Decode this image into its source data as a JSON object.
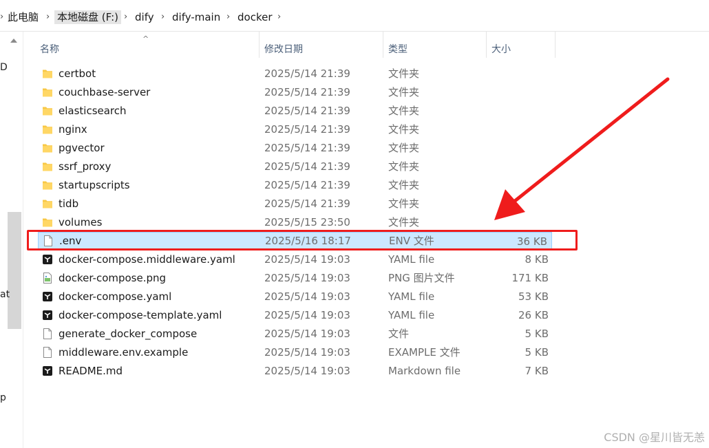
{
  "breadcrumb": [
    "此电脑",
    "本地磁盘 (F:)",
    "dify",
    "dify-main",
    "docker"
  ],
  "nav_fragments": [
    "D",
    "at",
    "p"
  ],
  "columns": {
    "name": "名称",
    "date": "修改日期",
    "type": "类型",
    "size": "大小"
  },
  "files": [
    {
      "name": "certbot",
      "date": "2025/5/14 21:39",
      "type": "文件夹",
      "size": "",
      "icon": "folder-icon"
    },
    {
      "name": "couchbase-server",
      "date": "2025/5/14 21:39",
      "type": "文件夹",
      "size": "",
      "icon": "folder-icon"
    },
    {
      "name": "elasticsearch",
      "date": "2025/5/14 21:39",
      "type": "文件夹",
      "size": "",
      "icon": "folder-icon"
    },
    {
      "name": "nginx",
      "date": "2025/5/14 21:39",
      "type": "文件夹",
      "size": "",
      "icon": "folder-icon"
    },
    {
      "name": "pgvector",
      "date": "2025/5/14 21:39",
      "type": "文件夹",
      "size": "",
      "icon": "folder-icon"
    },
    {
      "name": "ssrf_proxy",
      "date": "2025/5/14 21:39",
      "type": "文件夹",
      "size": "",
      "icon": "folder-icon"
    },
    {
      "name": "startupscripts",
      "date": "2025/5/14 21:39",
      "type": "文件夹",
      "size": "",
      "icon": "folder-icon"
    },
    {
      "name": "tidb",
      "date": "2025/5/14 21:39",
      "type": "文件夹",
      "size": "",
      "icon": "folder-icon"
    },
    {
      "name": "volumes",
      "date": "2025/5/15 23:50",
      "type": "文件夹",
      "size": "",
      "icon": "folder-icon"
    },
    {
      "name": ".env",
      "date": "2025/5/16 18:17",
      "type": "ENV 文件",
      "size": "36 KB",
      "icon": "file-icon",
      "selected": true
    },
    {
      "name": "docker-compose.middleware.yaml",
      "date": "2025/5/14 19:03",
      "type": "YAML file",
      "size": "8 KB",
      "icon": "yaml-file-icon"
    },
    {
      "name": "docker-compose.png",
      "date": "2025/5/14 19:03",
      "type": "PNG 图片文件",
      "size": "171 KB",
      "icon": "image-file-icon"
    },
    {
      "name": "docker-compose.yaml",
      "date": "2025/5/14 19:03",
      "type": "YAML file",
      "size": "53 KB",
      "icon": "yaml-file-icon"
    },
    {
      "name": "docker-compose-template.yaml",
      "date": "2025/5/14 19:03",
      "type": "YAML file",
      "size": "26 KB",
      "icon": "yaml-file-icon"
    },
    {
      "name": "generate_docker_compose",
      "date": "2025/5/14 19:03",
      "type": "文件",
      "size": "5 KB",
      "icon": "file-icon"
    },
    {
      "name": "middleware.env.example",
      "date": "2025/5/14 19:03",
      "type": "EXAMPLE 文件",
      "size": "5 KB",
      "icon": "file-icon"
    },
    {
      "name": "README.md",
      "date": "2025/5/14 19:03",
      "type": "Markdown file",
      "size": "7 KB",
      "icon": "markdown-file-icon"
    }
  ],
  "watermark": "CSDN @星川皆无恙",
  "colors": {
    "highlight_box": "#ef1c1c",
    "selection": "#cce8ff",
    "folder": "#f8c846"
  }
}
